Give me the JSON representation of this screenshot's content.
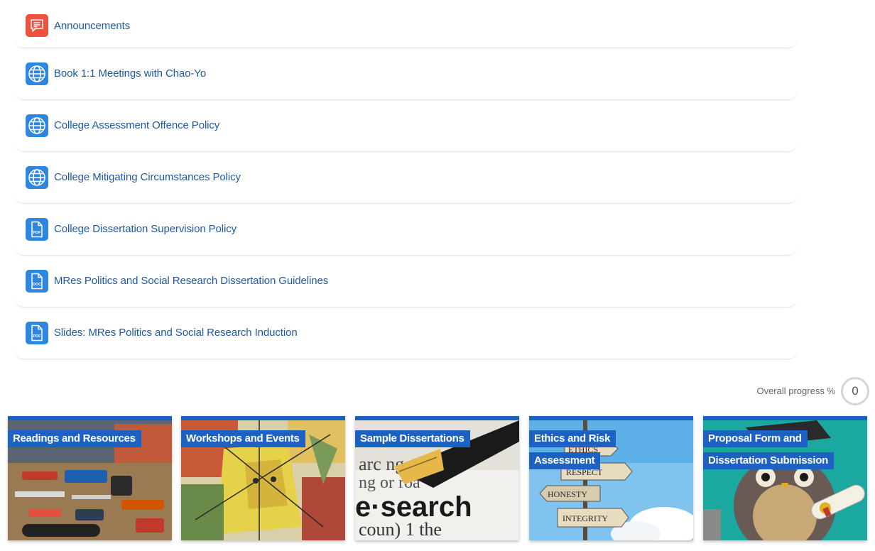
{
  "activities": [
    {
      "label": "Announcements",
      "icon": "forum-icon",
      "type": "forum"
    },
    {
      "label": "Book 1:1 Meetings with Chao-Yo",
      "icon": "globe-icon",
      "type": "url"
    },
    {
      "label": "College Assessment Offence Policy",
      "icon": "globe-icon",
      "type": "url"
    },
    {
      "label": "College Mitigating Circumstances Policy",
      "icon": "globe-icon",
      "type": "url"
    },
    {
      "label": "College Dissertation Supervision Policy",
      "icon": "pdf-file-icon",
      "type": "file",
      "badge": "PDF"
    },
    {
      "label": "MRes Politics and Social Research Dissertation Guidelines",
      "icon": "doc-file-icon",
      "type": "file",
      "badge": "DOC"
    },
    {
      "label": "Slides: MRes Politics and Social Research Induction",
      "icon": "pdf-file-icon",
      "type": "file",
      "badge": "PDF"
    }
  ],
  "progress": {
    "label": "Overall progress %",
    "value": "0"
  },
  "tiles": [
    {
      "title": "Readings and Resources",
      "image": "tools-workbench-photo"
    },
    {
      "title": "Workshops and Events",
      "image": "cubist-painting"
    },
    {
      "title": "Sample Dissertations",
      "image": "fountain-pen-research-photo"
    },
    {
      "title": "Ethics and Risk Assessment",
      "image": "ethics-signpost-photo",
      "signs": [
        "ETHICS",
        "RESPECT",
        "HONESTY",
        "INTEGRITY"
      ]
    },
    {
      "title": "Proposal Form and Dissertation Submission",
      "image": "graduate-owl-illustration"
    }
  ],
  "colors": {
    "link": "#1d5aa8",
    "accent": "#1565c0",
    "forum": "#f0513f",
    "resource": "#2e86de"
  }
}
